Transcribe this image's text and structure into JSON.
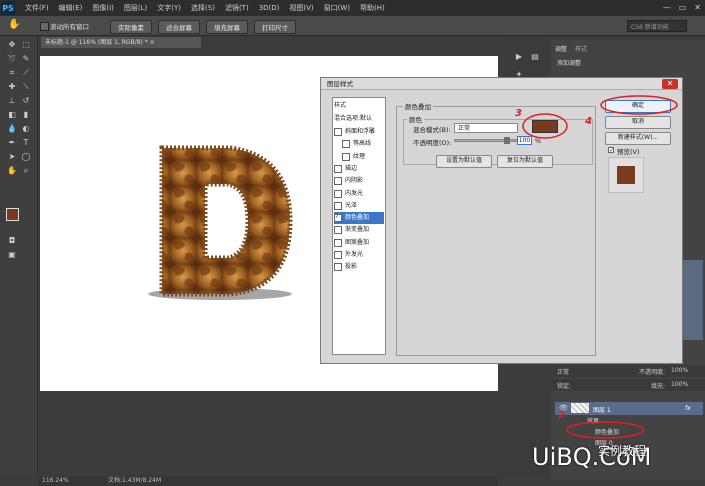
{
  "menu": {
    "app_badge": "PS",
    "items": [
      "文件(F)",
      "编辑(E)",
      "图像(I)",
      "图层(L)",
      "文字(Y)",
      "选择(S)",
      "滤镜(T)",
      "3D(D)",
      "视图(V)",
      "窗口(W)",
      "帮助(H)"
    ],
    "window_controls": [
      "—",
      "▭",
      "✕"
    ]
  },
  "options_bar": {
    "scroll_all": "滚动所有窗口",
    "buttons": [
      "实际像素",
      "适合屏幕",
      "填充屏幕",
      "打印尺寸"
    ],
    "workspace": "CS6 新增功能"
  },
  "document": {
    "tab": "未标题-1 @ 116% (图层 1, RGB/8) * ×",
    "status_zoom": "116.24%",
    "status_doc": "文档:1.43M/8.24M"
  },
  "panel": {
    "tabs": [
      "调整",
      "样式"
    ],
    "adjust_title": "添加调整",
    "blend_mode": "正常",
    "opacity_label": "不透明度:",
    "opacity_value": "100%",
    "lock_label": "锁定:",
    "fill_label": "填充:",
    "fill_value": "100%",
    "layer_name": "图层 1",
    "fx": "fx",
    "effects_label": "效果",
    "effect_item": "颜色叠加",
    "layer2": "图层 0"
  },
  "dialog": {
    "title": "图层样式",
    "close": "✕",
    "styles_header": "样式",
    "blend_options": "混合选项:默认",
    "items": [
      {
        "label": "斜面和浮雕",
        "checked": false,
        "indent": false
      },
      {
        "label": "等高线",
        "checked": false,
        "indent": true
      },
      {
        "label": "纹理",
        "checked": false,
        "indent": true
      },
      {
        "label": "描边",
        "checked": false,
        "indent": false
      },
      {
        "label": "内阴影",
        "checked": false,
        "indent": false
      },
      {
        "label": "内发光",
        "checked": false,
        "indent": false
      },
      {
        "label": "光泽",
        "checked": false,
        "indent": false
      },
      {
        "label": "颜色叠加",
        "checked": true,
        "indent": false,
        "selected": true
      },
      {
        "label": "渐变叠加",
        "checked": false,
        "indent": false
      },
      {
        "label": "图案叠加",
        "checked": false,
        "indent": false
      },
      {
        "label": "外发光",
        "checked": false,
        "indent": false
      },
      {
        "label": "投影",
        "checked": false,
        "indent": false
      }
    ],
    "section_title": "颜色叠加",
    "subsection_title": "颜色",
    "blend_label": "混合模式(B):",
    "blend_value": "正常",
    "opacity_label": "不透明度(O):",
    "opacity_value": "100",
    "opacity_unit": "%",
    "set_default": "设置为默认值",
    "reset_default": "复位为默认值",
    "ok": "确定",
    "cancel": "取消",
    "new_style": "新建样式(W)...",
    "preview": "预览(V)",
    "overlay_color": "#7a3b1c"
  },
  "annotations": {
    "step3": "3",
    "step4": "4",
    "step2": "2"
  },
  "watermark": {
    "brand": "UiBQ.CoM",
    "cn": "实例教程"
  }
}
